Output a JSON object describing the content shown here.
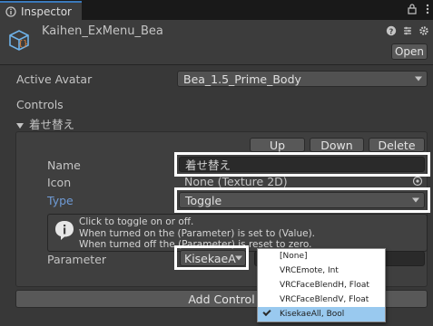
{
  "tabbar": {
    "title": "Inspector",
    "lock_icon": "lock-icon",
    "menu_icon": "kebab-menu-icon"
  },
  "header": {
    "object_name": "Kaihen_ExMenu_Bea",
    "open_label": "Open"
  },
  "active_avatar": {
    "label": "Active Avatar",
    "value": "Bea_1.5_Prime_Body"
  },
  "controls": {
    "label": "Controls",
    "item_title": "着せ替え",
    "up_label": "Up",
    "down_label": "Down",
    "delete_label": "Delete",
    "name_label": "Name",
    "name_value": "着せ替え",
    "icon_label": "Icon",
    "icon_value": "None (Texture 2D)",
    "type_label": "Type",
    "type_value": "Toggle",
    "help": [
      "Click to toggle on or off.",
      "When turned on the (Parameter) is set to (Value).",
      "When turned off the (Parameter) is reset to zero."
    ],
    "parameter_label": "Parameter",
    "parameter_value": "KisekaeA"
  },
  "popup": {
    "options": [
      "[None]",
      "VRCEmote, Int",
      "VRCFaceBlendH, Float",
      "VRCFaceBlendV, Float",
      "KisekaeAll, Bool"
    ],
    "selected_index": 4
  },
  "add_control_label": "Add Control",
  "colors": {
    "accent": "#3a79bb",
    "highlight": "#ffffff",
    "popup_selected": "#99c9ef",
    "type_label": "#6f9bd6"
  }
}
